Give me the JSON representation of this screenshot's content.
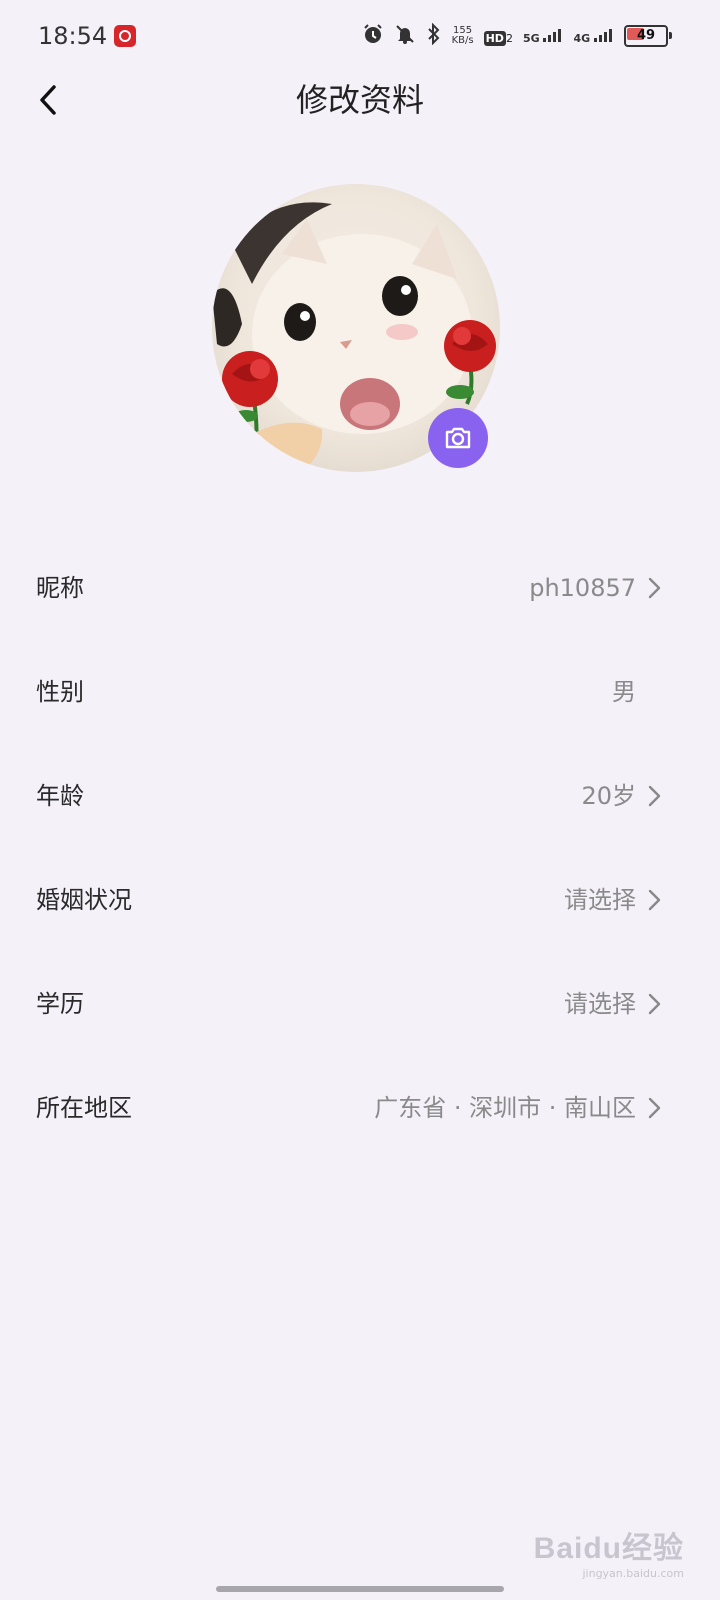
{
  "status_bar": {
    "time": "18:54",
    "speed_value": "155",
    "speed_unit": "KB/s",
    "hd_label": "HD",
    "hd_sub": "2",
    "net_5g": "5G",
    "net_4g": "4G",
    "battery_level": "49",
    "icons": [
      "netease-music-icon",
      "alarm-icon",
      "mute-icon",
      "bluetooth-icon",
      "signal-icon",
      "battery-icon"
    ]
  },
  "header": {
    "title": "修改资料",
    "back_icon": "chevron-left-icon"
  },
  "avatar": {
    "camera_icon": "camera-icon",
    "accent": "#8a62f0"
  },
  "profile_fields": [
    {
      "label": "昵称",
      "value": "ph10857",
      "has_chevron": true
    },
    {
      "label": "性别",
      "value": "男",
      "has_chevron": false
    },
    {
      "label": "年龄",
      "value": "20岁",
      "has_chevron": true
    },
    {
      "label": "婚姻状况",
      "value": "请选择",
      "has_chevron": true
    },
    {
      "label": "学历",
      "value": "请选择",
      "has_chevron": true
    },
    {
      "label": "所在地区",
      "value": "广东省 · 深圳市 · 南山区",
      "has_chevron": true
    }
  ],
  "watermark": {
    "logo_text": "Baidu经验",
    "sub_text": "jingyan.baidu.com"
  },
  "colors": {
    "background": "#f4f1f9",
    "label_text": "#2a2a2a",
    "value_text": "#8a8a8a",
    "accent": "#8a62f0"
  }
}
